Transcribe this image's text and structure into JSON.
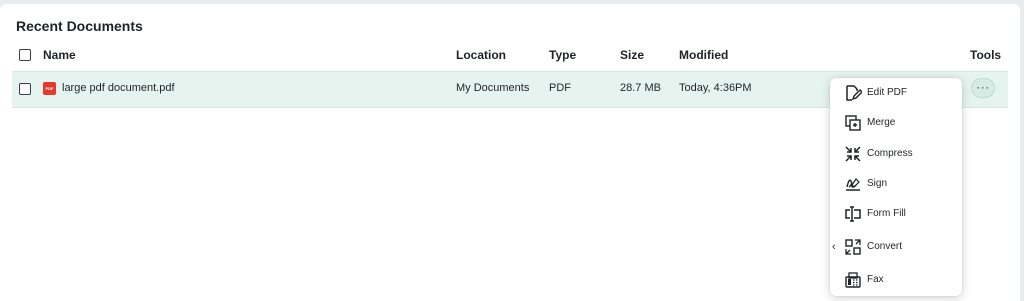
{
  "section": {
    "title": "Recent Documents"
  },
  "table": {
    "headers": {
      "name": "Name",
      "location": "Location",
      "type": "Type",
      "size": "Size",
      "modified": "Modified",
      "tools": "Tools"
    },
    "rows": [
      {
        "file_badge": "PDF",
        "name": "large pdf document.pdf",
        "location": "My Documents",
        "type": "PDF",
        "size": "28.7 MB",
        "modified": "Today, 4:36PM",
        "more_label": "···"
      }
    ]
  },
  "tools_menu": {
    "items": [
      {
        "label": "Edit PDF",
        "icon": "edit-pdf-icon"
      },
      {
        "label": "Merge",
        "icon": "merge-icon"
      },
      {
        "label": "Compress",
        "icon": "compress-icon"
      },
      {
        "label": "Sign",
        "icon": "sign-icon"
      },
      {
        "label": "Form Fill",
        "icon": "form-fill-icon"
      },
      {
        "label": "Convert",
        "icon": "convert-icon",
        "has_submenu": true
      },
      {
        "label": "Fax",
        "icon": "fax-icon"
      }
    ]
  },
  "colors": {
    "selected_row": "#e6f4ef",
    "pdf_badge": "#e5392e",
    "page_bg": "#e9ecee"
  }
}
